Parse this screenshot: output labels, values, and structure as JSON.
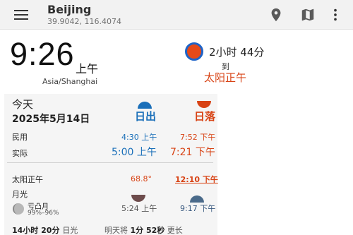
{
  "appbar": {
    "title": "Beijing",
    "coords": "39.9042, 116.4074"
  },
  "clock": {
    "time": "9:26",
    "ampm": "上午",
    "timezone": "Asia/Shanghai"
  },
  "next_event": {
    "countdown": "2小时 44分",
    "to": "到",
    "event": "太阳正午"
  },
  "day": {
    "label": "今天",
    "date": "2025年5月14日",
    "sunrise_header": "日出",
    "sunset_header": "日落",
    "civil_label": "民用",
    "civil_rise": "4:30 上午",
    "civil_set": "7:52 下午",
    "actual_label": "实际",
    "actual_rise": "5:00 上午",
    "actual_set": "7:21 下午",
    "noon_label": "太阳正午",
    "noon_angle": "68.8°",
    "noon_time": "12:10 下午",
    "moon_label": "月光",
    "moon_phase": "亏凸月",
    "moon_illum": "99%–96%",
    "moonset": "5:24 上午",
    "moonrise": "9:17 下午",
    "daylight_hours": "14小时",
    "daylight_minutes": "20分",
    "daylight_label": "日光",
    "tomorrow_prefix": "明天将",
    "tomorrow_diff": "1分 52秒",
    "tomorrow_suffix": "更长"
  },
  "colors": {
    "sun_blue": "#1a6fb9",
    "sun_orange": "#d84315",
    "moon_dark": "#6d4c4c",
    "moon_blue": "#4a6a8a"
  },
  "icons": [
    "menu-icon",
    "location-pin-icon",
    "map-icon",
    "more-vert-icon"
  ]
}
